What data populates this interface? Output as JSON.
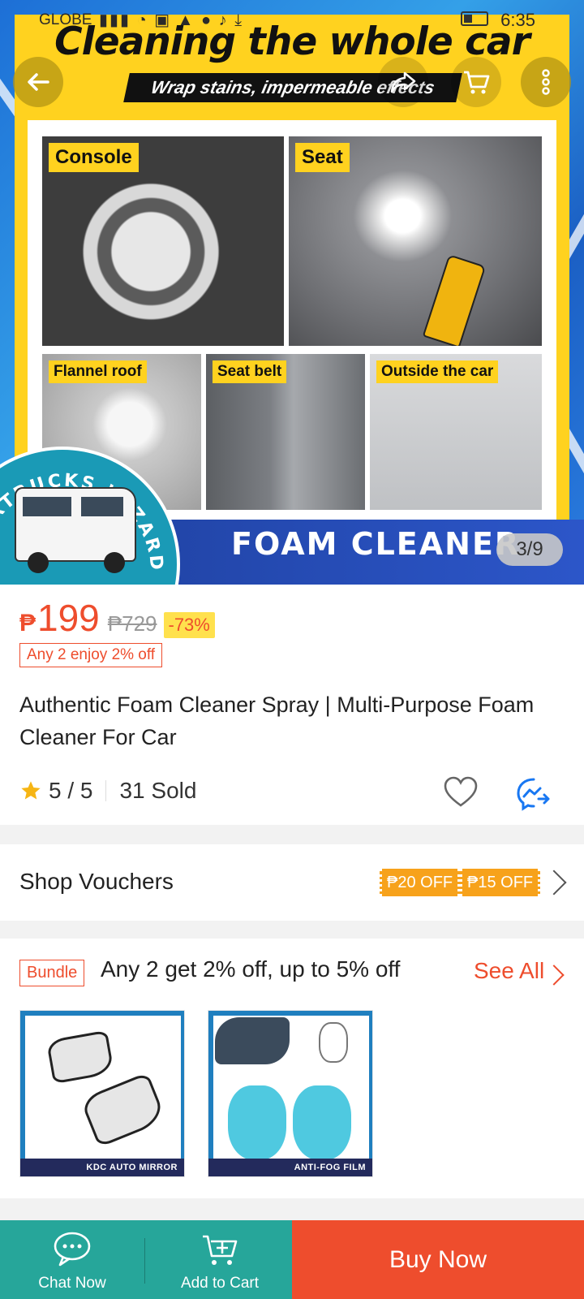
{
  "status_bar": {
    "carrier": "GLOBE",
    "time": "6:35"
  },
  "hero": {
    "poster_title": "Cleaning the whole car",
    "poster_subtitle": "Wrap stains, impermeable effects",
    "photo_tags": [
      "Console",
      "Seat",
      "Flannel roof",
      "Seat belt",
      "Outside the car"
    ],
    "banner_text": "FOAM CLEANER",
    "logo_text": "CARTRUCKS WIZARDS",
    "image_counter": "3/9"
  },
  "product": {
    "currency": "₱",
    "price": "199",
    "old_price": "₱729",
    "discount": "-73%",
    "promo": "Any 2 enjoy 2% off",
    "title": "Authentic Foam Cleaner Spray | Multi-Purpose Foam Cleaner For Car",
    "rating": "5 / 5",
    "sold": "31 Sold"
  },
  "vouchers": {
    "label": "Shop Vouchers",
    "chips": [
      "₱20 OFF",
      "₱15 OFF"
    ]
  },
  "bundle": {
    "tag": "Bundle",
    "text": "Any 2 get 2% off, up to 5% off",
    "see_all": "See All",
    "items": [
      {
        "caption": "KDC AUTO MIRROR"
      },
      {
        "caption": "ANTI-FOG FILM"
      }
    ]
  },
  "bottom_bar": {
    "chat": "Chat Now",
    "add_to_cart": "Add to Cart",
    "buy_now": "Buy Now"
  },
  "colors": {
    "accent": "#ee4d2d",
    "teal": "#26a69a",
    "voucher": "#f7a21b"
  }
}
